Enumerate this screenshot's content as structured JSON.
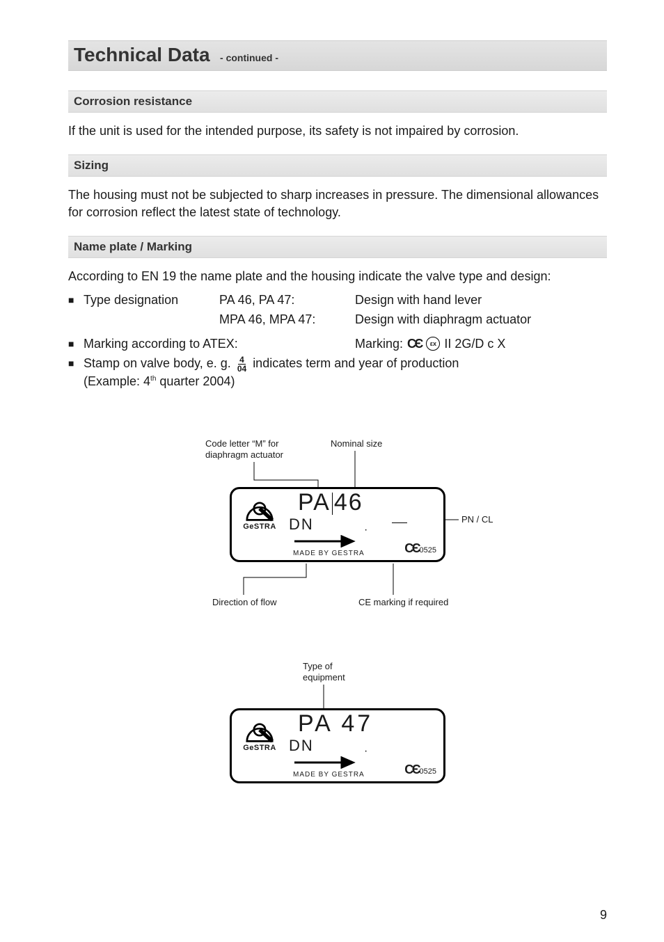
{
  "page_number": "9",
  "heading": {
    "title": "Technical Data",
    "continued": "- continued -"
  },
  "sections": {
    "corrosion": {
      "title": "Corrosion resistance",
      "text": "If the unit is used for the intended purpose, its safety is not impaired by corrosion."
    },
    "sizing": {
      "title": "Sizing",
      "text": "The housing must not be subjected to sharp increases in pressure. The dimensional allowances for corrosion reflect the latest state of technology."
    },
    "nameplate": {
      "title": "Name plate / Marking",
      "intro": "According to EN 19 the name plate and the housing indicate the valve type and design:",
      "type_designation": {
        "label": "Type designation",
        "r1_models": "PA 46, PA 47:",
        "r1_desc": "Design with hand lever",
        "r2_models": "MPA 46, MPA 47:",
        "r2_desc": "Design with diaphragm actuator"
      },
      "atex": {
        "label": "Marking according to ATEX:",
        "marking_prefix": "Marking:",
        "marking_code": "II 2G/D c X"
      },
      "stamp": {
        "text_before": "Stamp on valve body, e. g.",
        "frac_top": "4",
        "frac_bot": "04",
        "text_after": "indicates term and year of production",
        "example_before": "(Example: 4",
        "example_th": "th",
        "example_after": " quarter 2004)"
      }
    }
  },
  "figure1": {
    "callouts": {
      "code_letter": "Code letter “M” for diaphragm actuator",
      "nominal_size": "Nominal size",
      "pn_cl": "PN / CL",
      "direction_flow": "Direction of flow",
      "ce_marking": "CE marking if required"
    },
    "plate": {
      "model_left": "PA",
      "model_right": "46",
      "dn": "DN",
      "made_by": "MADE BY GESTRA",
      "ce_num": "0525",
      "brand": "GeSTRA"
    }
  },
  "figure2": {
    "callouts": {
      "type_equipment": "Type of equipment"
    },
    "plate": {
      "model": "PA 47",
      "dn": "DN",
      "made_by": "MADE BY GESTRA",
      "ce_num": "0525",
      "brand": "GeSTRA"
    }
  }
}
